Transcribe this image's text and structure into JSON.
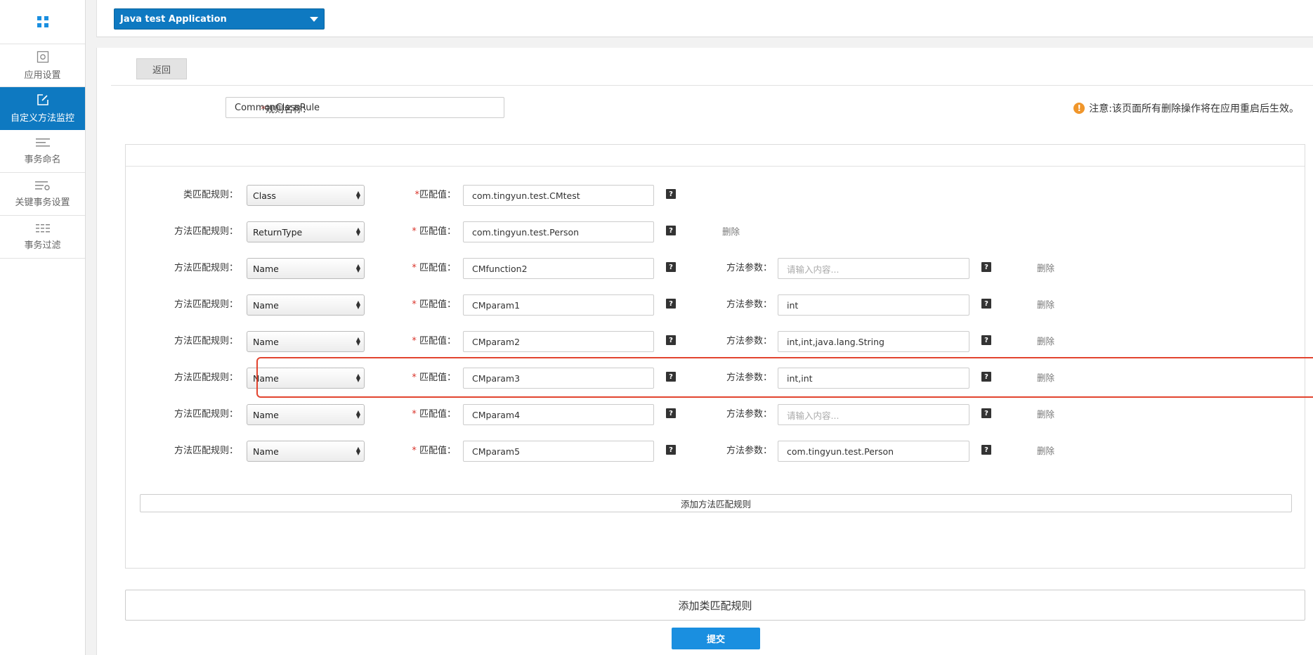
{
  "sidebar": {
    "items": [
      {
        "label": "应用设置",
        "icon": "app-settings-icon"
      },
      {
        "label": "自定义方法监控",
        "icon": "edit-icon",
        "active": true
      },
      {
        "label": "事务命名",
        "icon": "list-icon"
      },
      {
        "label": "关键事务设置",
        "icon": "key-transaction-icon"
      },
      {
        "label": "事务过滤",
        "icon": "filter-icon"
      }
    ]
  },
  "topbar": {
    "app_name": "Java test Application"
  },
  "back_label": "返回",
  "rule": {
    "label": "规则名称：",
    "value": "CommonClassRule"
  },
  "notice": "注意:该页面所有删除操作将在应用重启后生效。",
  "class_rule": {
    "label": "类匹配规则：",
    "type": "Class",
    "match_label": "匹配值：",
    "match_value": "com.tingyun.test.CMtest",
    "help": "?"
  },
  "method_rules": [
    {
      "label": "方法匹配规则：",
      "type": "ReturnType",
      "match_label": "匹配值：",
      "match_value": "com.tingyun.test.Person",
      "params_label": "",
      "params_value": "",
      "params_placeholder": "",
      "delete": "删除"
    },
    {
      "label": "方法匹配规则：",
      "type": "Name",
      "match_label": "匹配值：",
      "match_value": "CMfunction2",
      "params_label": "方法参数：",
      "params_value": "",
      "params_placeholder": "请输入内容...",
      "delete": "删除"
    },
    {
      "label": "方法匹配规则：",
      "type": "Name",
      "match_label": "匹配值：",
      "match_value": "CMparam1",
      "params_label": "方法参数：",
      "params_value": "int",
      "params_placeholder": "",
      "delete": "删除",
      "highlighted": true
    },
    {
      "label": "方法匹配规则：",
      "type": "Name",
      "match_label": "匹配值：",
      "match_value": "CMparam2",
      "params_label": "方法参数：",
      "params_value": "int,int,java.lang.String",
      "params_placeholder": "",
      "delete": "删除"
    },
    {
      "label": "方法匹配规则：",
      "type": "Name",
      "match_label": "匹配值：",
      "match_value": "CMparam3",
      "params_label": "方法参数：",
      "params_value": "int,int",
      "params_placeholder": "",
      "delete": "删除"
    },
    {
      "label": "方法匹配规则：",
      "type": "Name",
      "match_label": "匹配值：",
      "match_value": "CMparam4",
      "params_label": "方法参数：",
      "params_value": "",
      "params_placeholder": "请输入内容...",
      "delete": "删除"
    },
    {
      "label": "方法匹配规则：",
      "type": "Name",
      "match_label": "匹配值：",
      "match_value": "CMparam5",
      "params_label": "方法参数：",
      "params_value": "com.tingyun.test.Person",
      "params_placeholder": "",
      "delete": "删除"
    }
  ],
  "add_method_label": "添加方法匹配规则",
  "add_class_label": "添加类匹配规则",
  "submit_label": "提交",
  "colors": {
    "primary": "#0e79c1",
    "submit": "#1a8fe0",
    "warning": "#f0962b",
    "highlight": "#e2442f"
  }
}
